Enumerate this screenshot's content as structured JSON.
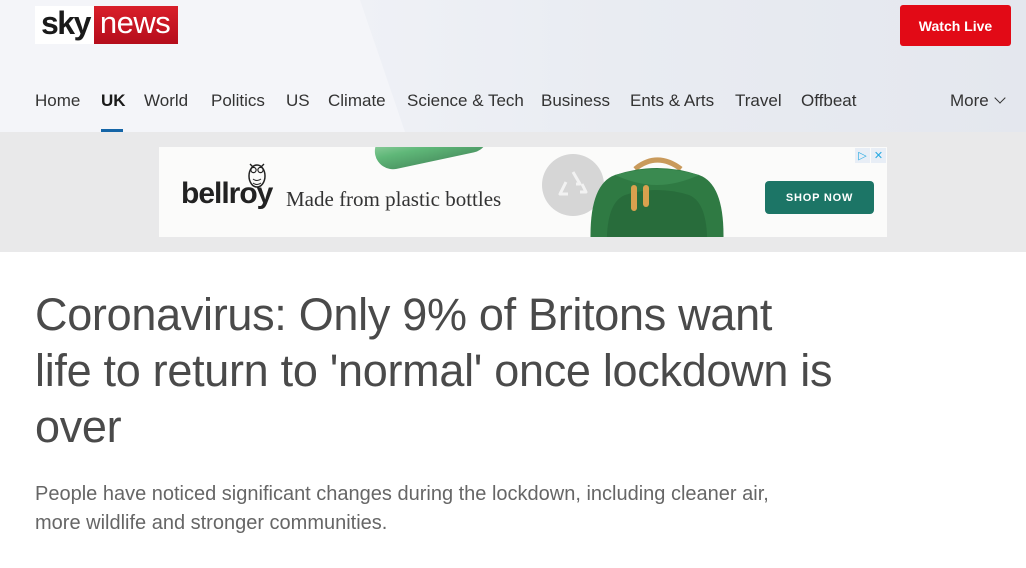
{
  "header": {
    "logo": {
      "sky": "sky",
      "news": "news"
    },
    "watch_live_label": "Watch Live"
  },
  "nav": {
    "items": [
      {
        "label": "Home"
      },
      {
        "label": "UK",
        "active": true
      },
      {
        "label": "World"
      },
      {
        "label": "Politics"
      },
      {
        "label": "US"
      },
      {
        "label": "Climate"
      },
      {
        "label": "Science & Tech"
      },
      {
        "label": "Business"
      },
      {
        "label": "Ents & Arts"
      },
      {
        "label": "Travel"
      },
      {
        "label": "Offbeat"
      }
    ],
    "more_label": "More",
    "more_icon": "chevron-down-icon"
  },
  "ad": {
    "brand": "bellroy",
    "tagline": "Made from plastic bottles",
    "cta": "SHOP NOW",
    "icons": [
      "owl-icon",
      "recycle-icon",
      "adchoices-icon",
      "close-icon"
    ]
  },
  "article": {
    "headline": "Coronavirus: Only 9% of Britons want life to return to 'normal' once lockdown is over",
    "standfirst": "People have noticed significant changes during the lockdown, including cleaner air, more wildlife and stronger communities."
  },
  "colors": {
    "brand_red": "#e20a16",
    "nav_active_underline": "#1565a7",
    "ad_cta": "#1c7566"
  }
}
